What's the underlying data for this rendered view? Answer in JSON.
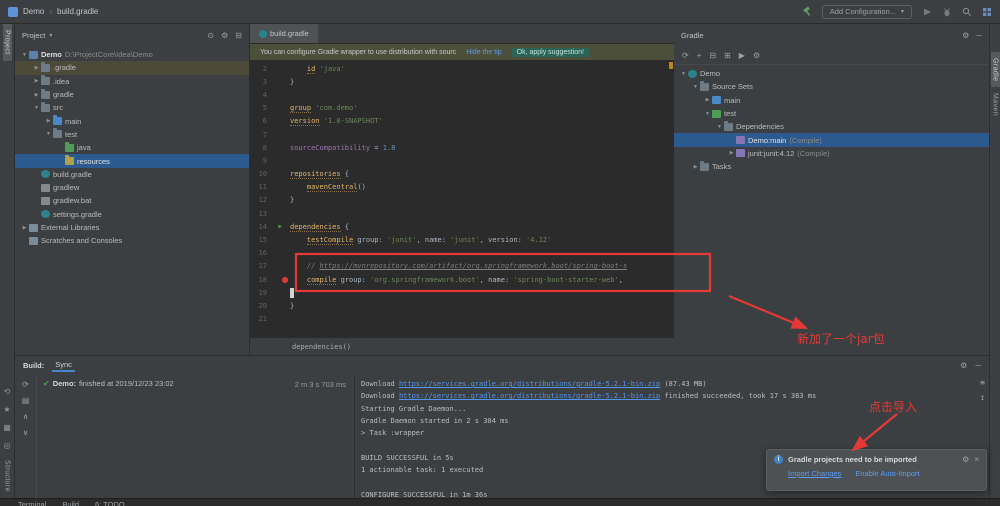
{
  "colors": {
    "annotation_red": "#e53935",
    "link_blue": "#589df6",
    "selection_blue": "#2d5a8e",
    "success_green": "#4f9f57",
    "editor_bg": "#2b2b2b",
    "panel_bg": "#3c3f41"
  },
  "app": {
    "title_breadcrumb": [
      "Demo",
      "build.gradle"
    ],
    "add_configuration_label": "Add Configuration..."
  },
  "left_stripe": {
    "top_label": "Project",
    "bottom_label": "Structure"
  },
  "right_stripe": {
    "labels": [
      "Gradle",
      "Maven"
    ]
  },
  "project_panel": {
    "title": "Project",
    "items": [
      {
        "indent": 0,
        "exp": "open",
        "icon": "project",
        "label": "Demo",
        "extra": "D:\\ProjectCore\\Idea\\Demo",
        "bold": true
      },
      {
        "indent": 1,
        "exp": "closed",
        "icon": "folder-excluded",
        "label": ".gradle",
        "hl": true
      },
      {
        "indent": 1,
        "exp": "closed",
        "icon": "folder-excluded",
        "label": ".idea"
      },
      {
        "indent": 1,
        "exp": "closed",
        "icon": "folder",
        "label": "gradle"
      },
      {
        "indent": 1,
        "exp": "open",
        "icon": "folder",
        "label": "src"
      },
      {
        "indent": 2,
        "exp": "closed",
        "icon": "folder-source",
        "label": "main"
      },
      {
        "indent": 2,
        "exp": "open",
        "icon": "folder",
        "label": "test"
      },
      {
        "indent": 3,
        "exp": "none",
        "icon": "folder-test",
        "label": "java"
      },
      {
        "indent": 3,
        "exp": "none",
        "icon": "folder-resources",
        "label": "resources",
        "selected": true
      },
      {
        "indent": 1,
        "exp": "none",
        "icon": "file-gradle",
        "label": "build.gradle"
      },
      {
        "indent": 1,
        "exp": "none",
        "icon": "file",
        "label": "gradlew"
      },
      {
        "indent": 1,
        "exp": "none",
        "icon": "file",
        "label": "gradlew.bat"
      },
      {
        "indent": 1,
        "exp": "none",
        "icon": "file-gradle",
        "label": "settings.gradle"
      },
      {
        "indent": 0,
        "exp": "closed",
        "icon": "library",
        "label": "External Libraries"
      },
      {
        "indent": 0,
        "exp": "none",
        "icon": "scratches",
        "label": "Scratches and Consoles"
      }
    ]
  },
  "editor": {
    "tab_label": "build.gradle",
    "banner": {
      "message": "You can configure Gradle wrapper to use distribution with sourc",
      "hide_link": "Hide the tip",
      "apply_link": "Ok, apply suggestion!"
    },
    "context_bar": "dependencies()",
    "lines": [
      {
        "n": "2",
        "segs": [
          {
            "t": "    ",
            "s": "pl"
          },
          {
            "t": "id",
            "s": "kw"
          },
          {
            "t": " ",
            "s": "pl"
          },
          {
            "t": "'java'",
            "s": "str"
          }
        ]
      },
      {
        "n": "3",
        "segs": [
          {
            "t": "}",
            "s": "pl"
          }
        ]
      },
      {
        "n": "4",
        "segs": []
      },
      {
        "n": "5",
        "segs": [
          {
            "t": "group",
            "s": "kw"
          },
          {
            "t": " ",
            "s": "pl"
          },
          {
            "t": "'com.demo'",
            "s": "str"
          }
        ]
      },
      {
        "n": "6",
        "segs": [
          {
            "t": "version",
            "s": "kw"
          },
          {
            "t": " ",
            "s": "pl"
          },
          {
            "t": "'1.0-SNAPSHOT'",
            "s": "str"
          }
        ]
      },
      {
        "n": "7",
        "segs": []
      },
      {
        "n": "8",
        "segs": [
          {
            "t": "sourceCompatibility",
            "s": "fld"
          },
          {
            "t": " = ",
            "s": "pl"
          },
          {
            "t": "1.8",
            "s": "num"
          }
        ]
      },
      {
        "n": "9",
        "segs": []
      },
      {
        "n": "10",
        "segs": [
          {
            "t": "repositories",
            "s": "kw"
          },
          {
            "t": " {",
            "s": "pl"
          }
        ]
      },
      {
        "n": "11",
        "segs": [
          {
            "t": "    ",
            "s": "pl"
          },
          {
            "t": "mavenCentral",
            "s": "kw"
          },
          {
            "t": "()",
            "s": "pl"
          }
        ]
      },
      {
        "n": "12",
        "segs": [
          {
            "t": "}",
            "s": "pl"
          }
        ]
      },
      {
        "n": "13",
        "segs": []
      },
      {
        "n": "14",
        "gutter": "run",
        "segs": [
          {
            "t": "dependencies",
            "s": "kw"
          },
          {
            "t": " {",
            "s": "pl"
          }
        ]
      },
      {
        "n": "15",
        "segs": [
          {
            "t": "    ",
            "s": "pl"
          },
          {
            "t": "testCompile",
            "s": "kw"
          },
          {
            "t": " group: ",
            "s": "pl"
          },
          {
            "t": "'junit'",
            "s": "str"
          },
          {
            "t": ", name: ",
            "s": "pl"
          },
          {
            "t": "'junit'",
            "s": "str"
          },
          {
            "t": ", version: ",
            "s": "pl"
          },
          {
            "t": "'4.12'",
            "s": "str"
          }
        ]
      },
      {
        "n": "16",
        "segs": []
      },
      {
        "n": "17",
        "segs": [
          {
            "t": "    ",
            "s": "pl"
          },
          {
            "t": "// ",
            "s": "cm"
          },
          {
            "t": "https://mvnrepository.com/artifact/org.springframework.boot/spring-boot-s",
            "s": "cmu"
          }
        ]
      },
      {
        "n": "18",
        "gutter": "dot",
        "segs": [
          {
            "t": "    ",
            "s": "pl"
          },
          {
            "t": "compile",
            "s": "kw"
          },
          {
            "t": " group: ",
            "s": "pl"
          },
          {
            "t": "'org.springframework.boot'",
            "s": "str"
          },
          {
            "t": ", name: ",
            "s": "pl"
          },
          {
            "t": "'spring-boot-starter-web'",
            "s": "str"
          },
          {
            "t": ",",
            "s": "pl"
          }
        ]
      },
      {
        "n": "19",
        "cursor": true,
        "segs": []
      },
      {
        "n": "20",
        "segs": [
          {
            "t": "}",
            "s": "pl"
          }
        ]
      },
      {
        "n": "21",
        "segs": []
      }
    ]
  },
  "gradle_panel": {
    "title": "Gradle",
    "items": [
      {
        "indent": 0,
        "exp": "open",
        "icon": "gradle",
        "label": "Demo"
      },
      {
        "indent": 1,
        "exp": "open",
        "icon": "folder",
        "label": "Source Sets"
      },
      {
        "indent": 2,
        "exp": "closed",
        "icon": "sourceset-main",
        "label": "main"
      },
      {
        "indent": 2,
        "exp": "open",
        "icon": "sourceset-test",
        "label": "test"
      },
      {
        "indent": 3,
        "exp": "open",
        "icon": "folder",
        "label": "Dependencies"
      },
      {
        "indent": 4,
        "exp": "none",
        "icon": "dependency",
        "label": "Demo:main",
        "extra": "(Compile)",
        "selected": true
      },
      {
        "indent": 4,
        "exp": "closed",
        "icon": "dependency",
        "label": "junit:junit:4.12",
        "extra": "(Compile)"
      },
      {
        "indent": 1,
        "exp": "closed",
        "icon": "tasks",
        "label": "Tasks"
      }
    ]
  },
  "build_panel": {
    "title": "Build:",
    "tab": "Sync",
    "status": {
      "project": "Demo:",
      "text": " finished at 2019/12/23 23:02",
      "duration": "2 m 3 s 703 ms"
    },
    "console": [
      [
        {
          "t": "Download ",
          "s": "pl"
        },
        {
          "t": "https://services.gradle.org/distributions/gradle-5.2.1-bin.zip",
          "s": "link"
        },
        {
          "t": " (87.43 MB)",
          "s": "pl"
        }
      ],
      [
        {
          "t": "Download ",
          "s": "pl"
        },
        {
          "t": "https://services.gradle.org/distributions/gradle-5.2.1-bin.zip",
          "s": "link"
        },
        {
          "t": " finished succeeded, took 17 s 383 ms",
          "s": "pl"
        }
      ],
      [
        {
          "t": "Starting Gradle Daemon...",
          "s": "pl"
        }
      ],
      [
        {
          "t": "Gradle Daemon started in 2 s 304 ms",
          "s": "pl"
        }
      ],
      [
        {
          "t": "> Task :wrapper",
          "s": "pl"
        }
      ],
      [],
      [
        {
          "t": "BUILD SUCCESSFUL in 5s",
          "s": "pl"
        }
      ],
      [
        {
          "t": "1 actionable task: 1 executed",
          "s": "pl"
        }
      ],
      [],
      [
        {
          "t": "CONFIGURE SUCCESSFUL in 1m 36s",
          "s": "pl"
        }
      ]
    ]
  },
  "notification": {
    "title": "Gradle projects need to be imported",
    "import_link": "Import Changes",
    "auto_import_link": "Enable Auto-Import"
  },
  "annotations": {
    "jar_note": "新加了一个jar包",
    "import_note": "点击导入"
  },
  "status_bar": {
    "items": [
      "Terminal",
      "Build",
      "6: TODO"
    ]
  }
}
